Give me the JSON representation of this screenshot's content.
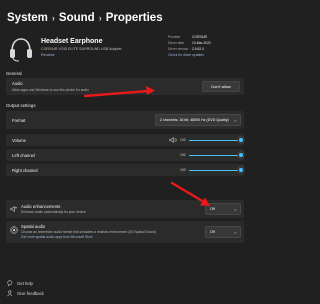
{
  "breadcrumb": [
    "System",
    "Sound",
    "Properties"
  ],
  "device": {
    "name": "Headset Earphone",
    "subtitle": "CORSAIR VOID ELITE SURROUND USB Adapter",
    "rename": "Rename",
    "info": [
      {
        "key": "Provider",
        "value": "CORSAIR"
      },
      {
        "key": "Driver date",
        "value": "10-Mar-2022"
      },
      {
        "key": "Driver version",
        "value": "2.5.62.0"
      }
    ],
    "check_driver_link": "Check for driver updates"
  },
  "general": {
    "heading": "General",
    "audio": {
      "label": "Audio",
      "desc": "Allow apps and Windows to use this device for audio",
      "button": "Don't allow"
    }
  },
  "output": {
    "heading": "Output settings",
    "format": {
      "label": "Format",
      "value": "2 channels, 16 bit, 48000 Hz (DVD Quality)"
    },
    "volume": {
      "label": "Volume",
      "value": "100",
      "level": 1.0
    },
    "left_channel": {
      "label": "Left channel",
      "value": "100",
      "level": 1.0
    },
    "right_channel": {
      "label": "Right channel",
      "value": "100",
      "level": 1.0
    }
  },
  "enhancements": {
    "label": "Audio enhancements",
    "desc": "Enhance audio automatically for your device",
    "value": "Off"
  },
  "spatial": {
    "label": "Spatial audio",
    "desc": "Choose an immersive audio format that simulates a realistic environment (3D Spatial Sound)",
    "link": "Get more spatial audio apps from Microsoft Store",
    "value": "Off"
  },
  "footer": {
    "help": "Get help",
    "feedback": "Give feedback"
  },
  "colors": {
    "accent": "#4cc2ff",
    "arrow": "#e8191c",
    "background": "#202020",
    "card": "#2b2b2b"
  }
}
